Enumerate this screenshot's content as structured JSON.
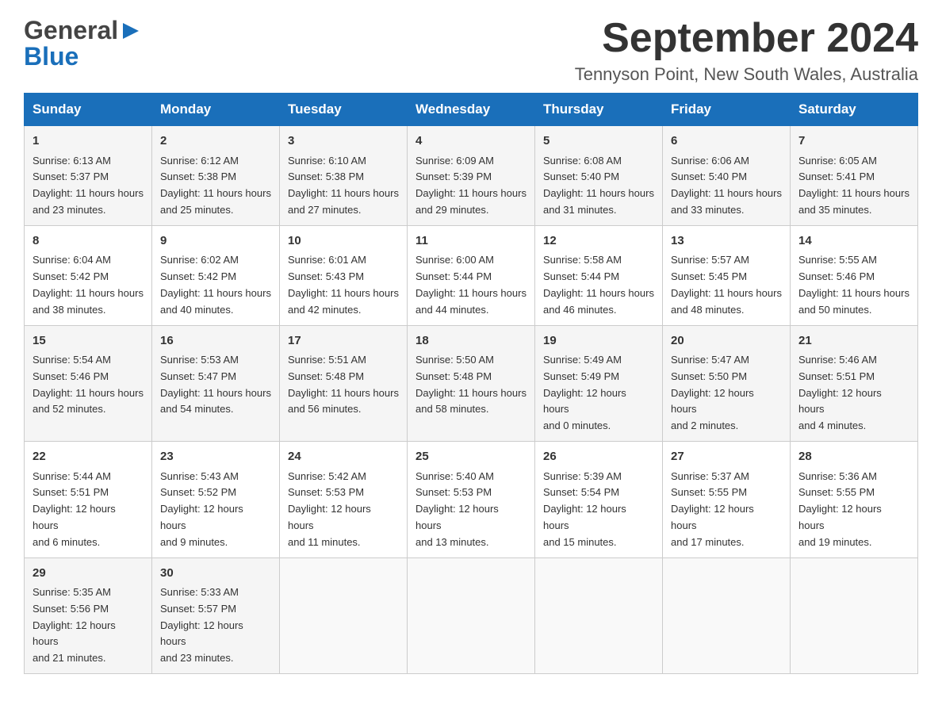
{
  "header": {
    "logo_general": "General",
    "logo_blue": "Blue",
    "month_title": "September 2024",
    "location": "Tennyson Point, New South Wales, Australia"
  },
  "days_of_week": [
    "Sunday",
    "Monday",
    "Tuesday",
    "Wednesday",
    "Thursday",
    "Friday",
    "Saturday"
  ],
  "weeks": [
    [
      {
        "day": "1",
        "sunrise": "6:13 AM",
        "sunset": "5:37 PM",
        "daylight": "11 hours and 23 minutes."
      },
      {
        "day": "2",
        "sunrise": "6:12 AM",
        "sunset": "5:38 PM",
        "daylight": "11 hours and 25 minutes."
      },
      {
        "day": "3",
        "sunrise": "6:10 AM",
        "sunset": "5:38 PM",
        "daylight": "11 hours and 27 minutes."
      },
      {
        "day": "4",
        "sunrise": "6:09 AM",
        "sunset": "5:39 PM",
        "daylight": "11 hours and 29 minutes."
      },
      {
        "day": "5",
        "sunrise": "6:08 AM",
        "sunset": "5:40 PM",
        "daylight": "11 hours and 31 minutes."
      },
      {
        "day": "6",
        "sunrise": "6:06 AM",
        "sunset": "5:40 PM",
        "daylight": "11 hours and 33 minutes."
      },
      {
        "day": "7",
        "sunrise": "6:05 AM",
        "sunset": "5:41 PM",
        "daylight": "11 hours and 35 minutes."
      }
    ],
    [
      {
        "day": "8",
        "sunrise": "6:04 AM",
        "sunset": "5:42 PM",
        "daylight": "11 hours and 38 minutes."
      },
      {
        "day": "9",
        "sunrise": "6:02 AM",
        "sunset": "5:42 PM",
        "daylight": "11 hours and 40 minutes."
      },
      {
        "day": "10",
        "sunrise": "6:01 AM",
        "sunset": "5:43 PM",
        "daylight": "11 hours and 42 minutes."
      },
      {
        "day": "11",
        "sunrise": "6:00 AM",
        "sunset": "5:44 PM",
        "daylight": "11 hours and 44 minutes."
      },
      {
        "day": "12",
        "sunrise": "5:58 AM",
        "sunset": "5:44 PM",
        "daylight": "11 hours and 46 minutes."
      },
      {
        "day": "13",
        "sunrise": "5:57 AM",
        "sunset": "5:45 PM",
        "daylight": "11 hours and 48 minutes."
      },
      {
        "day": "14",
        "sunrise": "5:55 AM",
        "sunset": "5:46 PM",
        "daylight": "11 hours and 50 minutes."
      }
    ],
    [
      {
        "day": "15",
        "sunrise": "5:54 AM",
        "sunset": "5:46 PM",
        "daylight": "11 hours and 52 minutes."
      },
      {
        "day": "16",
        "sunrise": "5:53 AM",
        "sunset": "5:47 PM",
        "daylight": "11 hours and 54 minutes."
      },
      {
        "day": "17",
        "sunrise": "5:51 AM",
        "sunset": "5:48 PM",
        "daylight": "11 hours and 56 minutes."
      },
      {
        "day": "18",
        "sunrise": "5:50 AM",
        "sunset": "5:48 PM",
        "daylight": "11 hours and 58 minutes."
      },
      {
        "day": "19",
        "sunrise": "5:49 AM",
        "sunset": "5:49 PM",
        "daylight": "12 hours and 0 minutes."
      },
      {
        "day": "20",
        "sunrise": "5:47 AM",
        "sunset": "5:50 PM",
        "daylight": "12 hours and 2 minutes."
      },
      {
        "day": "21",
        "sunrise": "5:46 AM",
        "sunset": "5:51 PM",
        "daylight": "12 hours and 4 minutes."
      }
    ],
    [
      {
        "day": "22",
        "sunrise": "5:44 AM",
        "sunset": "5:51 PM",
        "daylight": "12 hours and 6 minutes."
      },
      {
        "day": "23",
        "sunrise": "5:43 AM",
        "sunset": "5:52 PM",
        "daylight": "12 hours and 9 minutes."
      },
      {
        "day": "24",
        "sunrise": "5:42 AM",
        "sunset": "5:53 PM",
        "daylight": "12 hours and 11 minutes."
      },
      {
        "day": "25",
        "sunrise": "5:40 AM",
        "sunset": "5:53 PM",
        "daylight": "12 hours and 13 minutes."
      },
      {
        "day": "26",
        "sunrise": "5:39 AM",
        "sunset": "5:54 PM",
        "daylight": "12 hours and 15 minutes."
      },
      {
        "day": "27",
        "sunrise": "5:37 AM",
        "sunset": "5:55 PM",
        "daylight": "12 hours and 17 minutes."
      },
      {
        "day": "28",
        "sunrise": "5:36 AM",
        "sunset": "5:55 PM",
        "daylight": "12 hours and 19 minutes."
      }
    ],
    [
      {
        "day": "29",
        "sunrise": "5:35 AM",
        "sunset": "5:56 PM",
        "daylight": "12 hours and 21 minutes."
      },
      {
        "day": "30",
        "sunrise": "5:33 AM",
        "sunset": "5:57 PM",
        "daylight": "12 hours and 23 minutes."
      },
      null,
      null,
      null,
      null,
      null
    ]
  ],
  "labels": {
    "sunrise": "Sunrise:",
    "sunset": "Sunset:",
    "daylight": "Daylight:"
  }
}
